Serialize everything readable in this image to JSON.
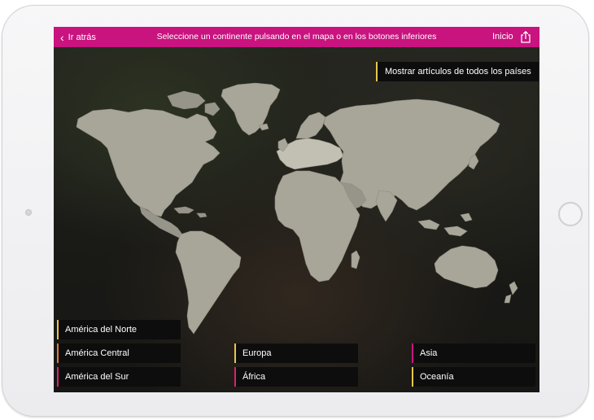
{
  "navbar": {
    "back_label": "Ir atrás",
    "title": "Seleccione un continente pulsando en el mapa o en los botones inferiores",
    "home_label": "Inicio",
    "share_icon": "share-icon",
    "back_icon": "chevron-left-icon",
    "color": "#c9137f"
  },
  "show_all_label": "Mostrar artículos de todos los países",
  "continents": [
    {
      "label": "América del Norte",
      "accent": "#e8c547"
    },
    {
      "label": "América Central",
      "accent": "#e07a3a"
    },
    {
      "label": "América del Sur",
      "accent": "#d6246e"
    },
    {
      "label": "Europa",
      "accent": "#e8c547"
    },
    {
      "label": "África",
      "accent": "#d6246e"
    },
    {
      "label": "Asia",
      "accent": "#c9137f"
    },
    {
      "label": "Oceanía",
      "accent": "#e8c547"
    }
  ]
}
